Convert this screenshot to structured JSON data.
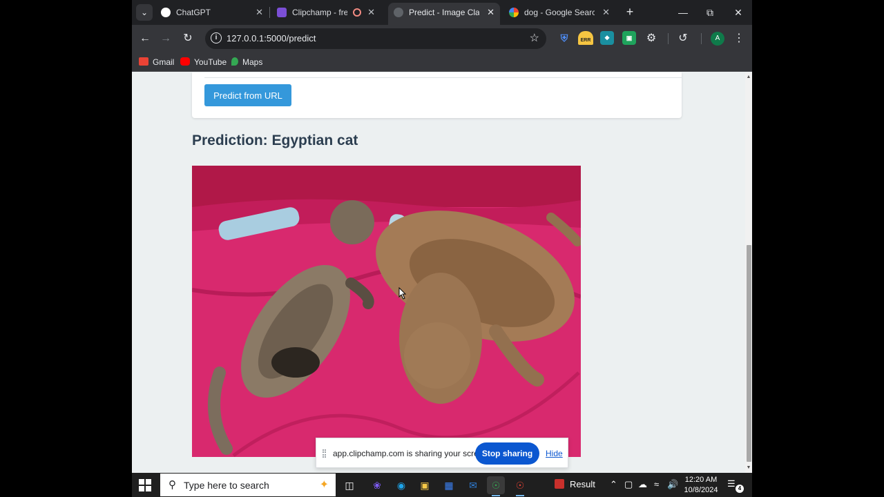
{
  "browser": {
    "tabs": [
      {
        "label": "ChatGPT",
        "icon": "chatgpt-icon"
      },
      {
        "label": "Clipchamp - free v",
        "icon": "clipchamp-icon"
      },
      {
        "label": "Predict - Image Classif",
        "icon": "globe-icon",
        "active": true
      },
      {
        "label": "dog - Google Search",
        "icon": "google-icon"
      }
    ],
    "url": "127.0.0.1:5000/predict",
    "extension_badge": "ERR",
    "profile_initial": "A"
  },
  "bookmarks": [
    {
      "label": "Gmail",
      "color": "#ea4335"
    },
    {
      "label": "YouTube",
      "color": "#ff0000"
    },
    {
      "label": "Maps",
      "color": "#34a853"
    }
  ],
  "page": {
    "predict_button": "Predict from URL",
    "prediction_title": "Prediction: Egyptian cat"
  },
  "share_bar": {
    "message": "app.clipchamp.com is sharing your screen.",
    "stop_label": "Stop sharing",
    "hide_label": "Hide"
  },
  "taskbar": {
    "search_placeholder": "Type here to search",
    "tray_label": "Result",
    "time": "12:20 AM",
    "date": "10/8/2024",
    "notification_count": "4"
  },
  "colors": {
    "accent_button": "#3498db",
    "share_button": "#0b57d0",
    "title_text": "#2c3e50"
  }
}
